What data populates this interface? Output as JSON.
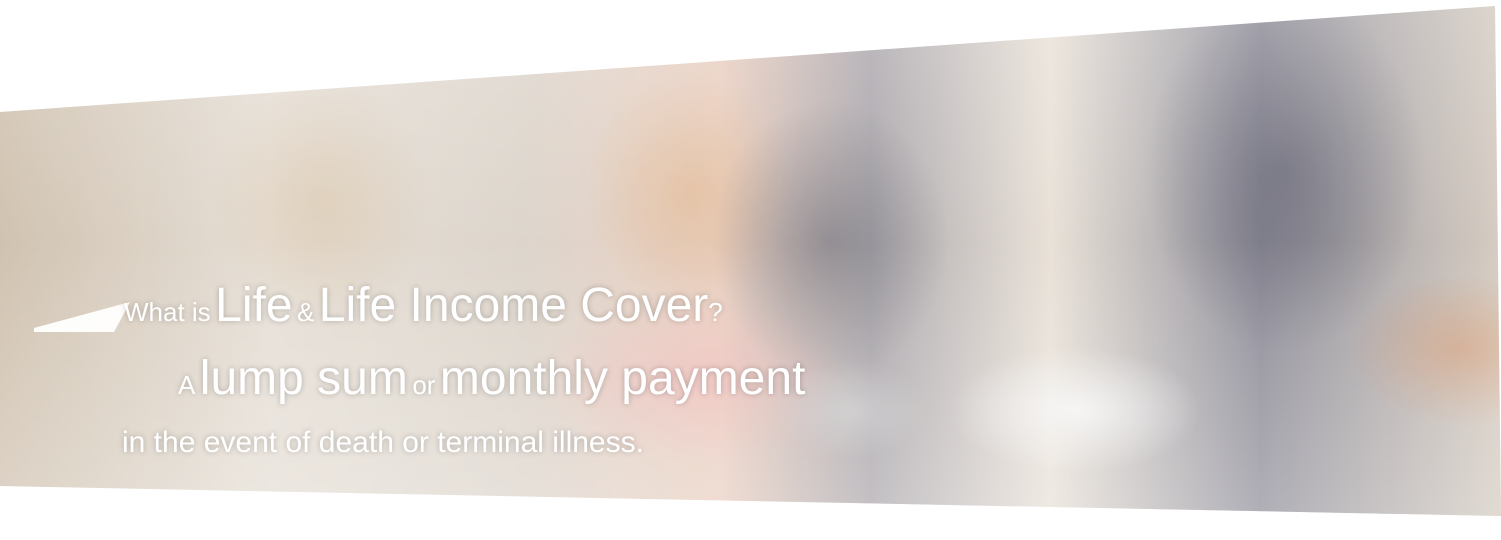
{
  "banner": {
    "line1": {
      "small1": "What is",
      "big1": "Life",
      "small2": "&",
      "big2": "Life Income Cover",
      "small3": "?"
    },
    "line2": {
      "small1": "A",
      "big1": "lump sum",
      "small2": "or",
      "big2": "monthly payment"
    },
    "line3": {
      "text": "in the event of death or terminal illness."
    }
  },
  "colors": {
    "headline_text": "#ffffff",
    "pointer": "#ffffff",
    "background": "#ffffff"
  },
  "icons": {
    "pointer": "triangle-pointer-icon"
  }
}
